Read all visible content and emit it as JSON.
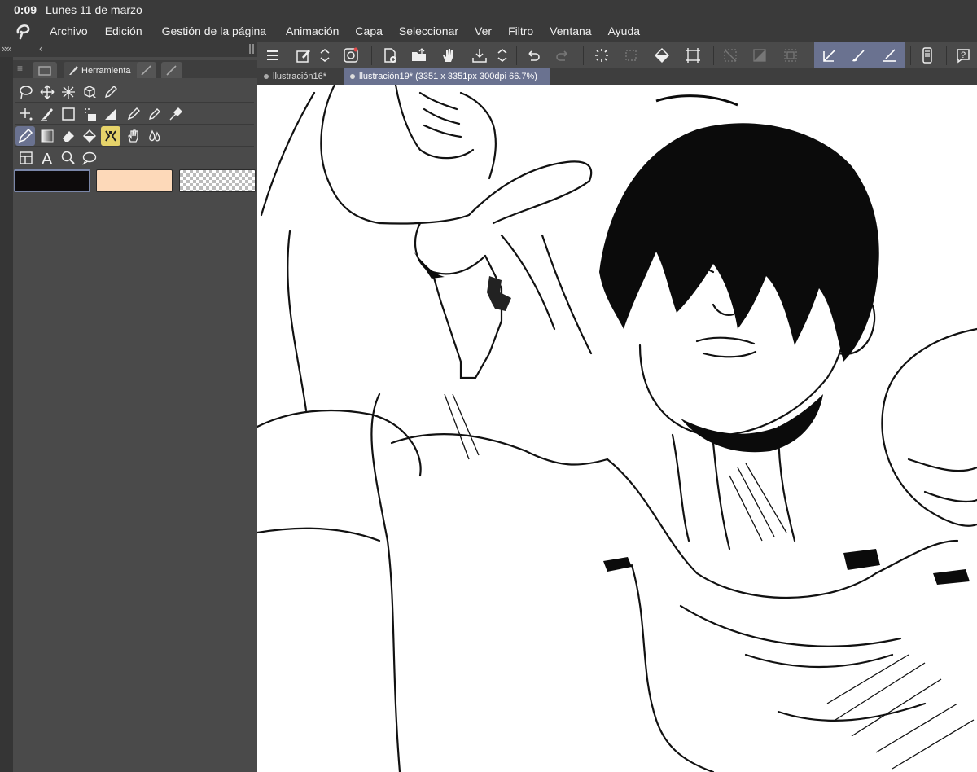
{
  "status_bar": {
    "time": "0:09",
    "date": "Lunes 11 de marzo"
  },
  "menu": {
    "items": [
      "Archivo",
      "Edición",
      "Gestión de la página",
      "Animación",
      "Capa",
      "Seleccionar",
      "Ver",
      "Filtro",
      "Ventana",
      "Ayuda"
    ]
  },
  "panel": {
    "tool_tab_label": "Herramienta",
    "colors": {
      "main": "#0d0b0c",
      "sub": "#fdd9b9"
    }
  },
  "tools": {
    "row1": [
      "lasso-select-icon",
      "move-icon",
      "auto-select-icon",
      "object-select-icon",
      "eyedropper-pen-icon"
    ],
    "row2": [
      "sparkle-icon",
      "brush-pen-icon",
      "rectangle-icon",
      "fill-dots-icon",
      "ruler-icon",
      "pen-nib-icon",
      "marker-icon",
      "dropper-icon"
    ],
    "row3": [
      "pen-icon",
      "gradient-icon",
      "eraser-icon",
      "fill-bucket-icon",
      "decoration-icon",
      "hand-icon",
      "blend-drops-icon"
    ],
    "row4": [
      "frame-icon",
      "text-icon",
      "zoom-icon",
      "balloon-icon"
    ]
  },
  "document_tabs": {
    "tab1": "llustración16*",
    "tab2": "llustración19* (3351 x 3351px 300dpi 66.7%)"
  },
  "accent_color": "#6a7290"
}
